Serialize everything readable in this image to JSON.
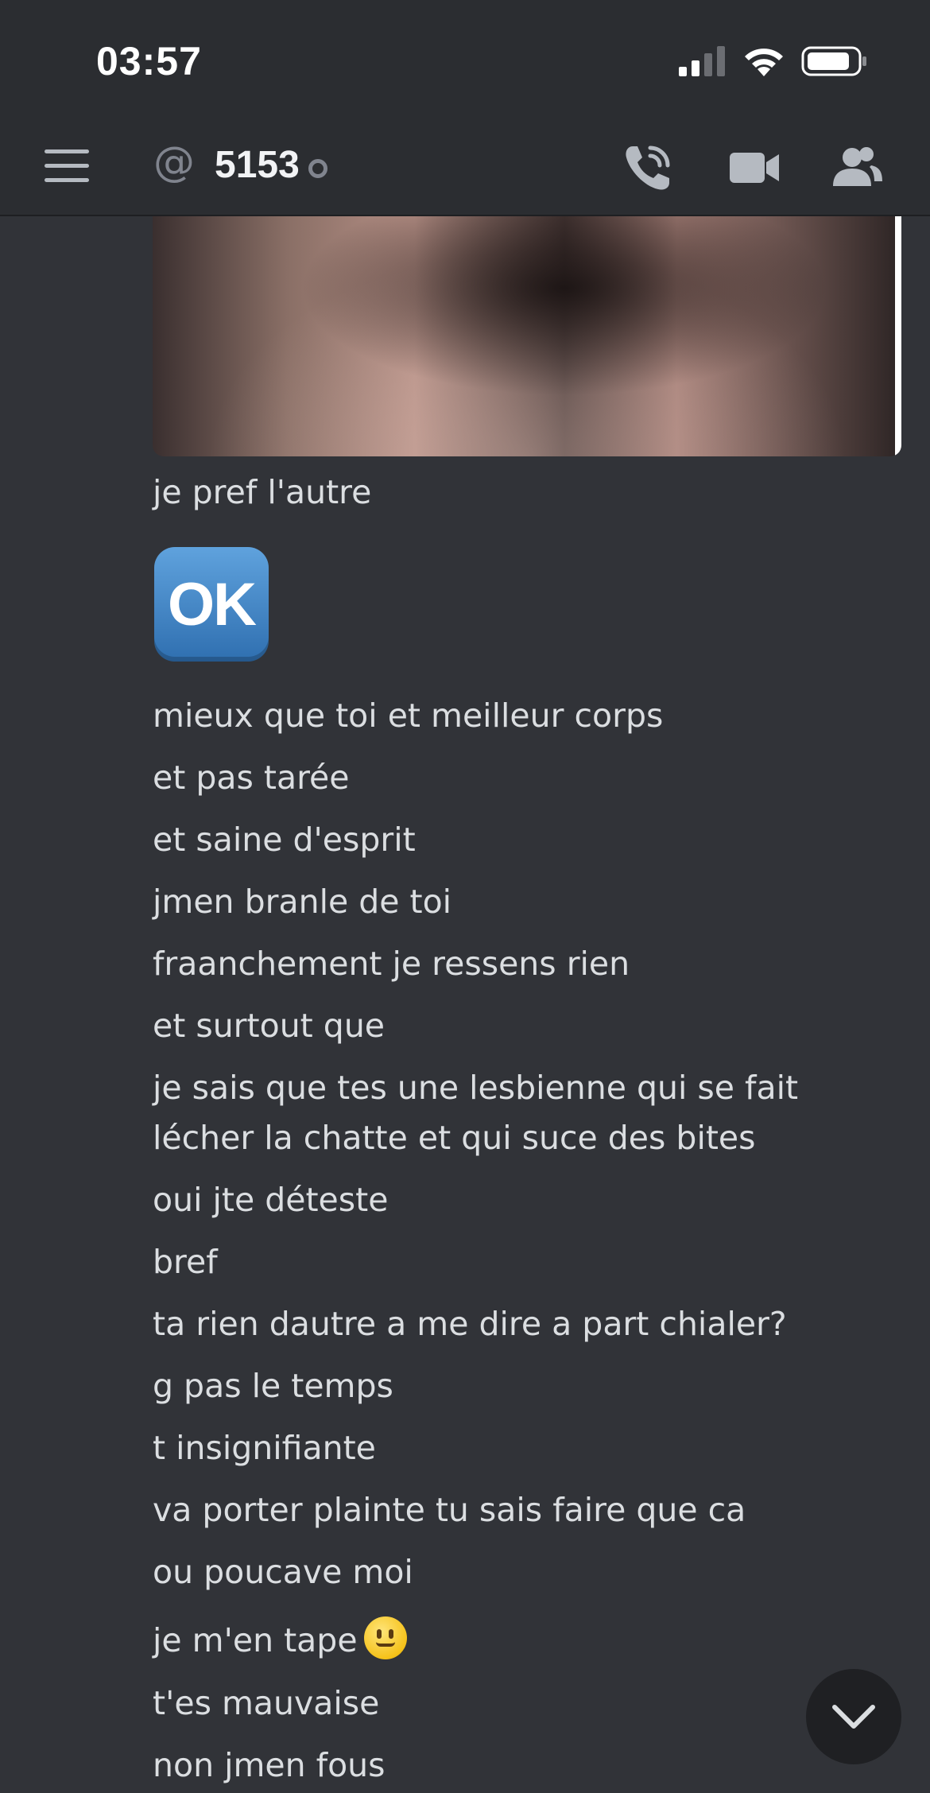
{
  "status_bar": {
    "time": "03:57"
  },
  "header": {
    "channel_prefix": "@",
    "channel_name": "5153",
    "icons": [
      "menu-icon",
      "at-icon",
      "phone-call-icon",
      "video-call-icon",
      "members-icon"
    ]
  },
  "messages": [
    "je pref l'autre",
    "mieux que toi et meilleur corps",
    "et pas tarée",
    "et saine d'esprit",
    "jmen branle de toi",
    "fraanchement je ressens rien",
    "et surtout que",
    "je sais que tes une lesbienne qui se fait lécher la chatte et qui suce des bites",
    "oui jte déteste",
    "bref",
    "ta rien dautre a me dire a part chialer?",
    "g pas le temps",
    "t insignifiante",
    "va porter plainte tu sais faire que ca",
    "ou poucave moi",
    "je m'en tape",
    "t'es mauvaise",
    "non jmen fous"
  ],
  "ok_emoji": "OK",
  "colors": {
    "background": "#313338",
    "header": "#2b2d31",
    "text": "#dbdee1"
  }
}
